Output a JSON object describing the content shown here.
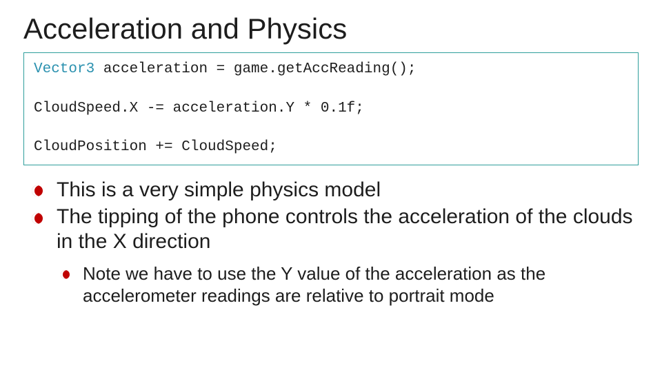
{
  "title": "Acceleration and Physics",
  "code": {
    "line1_type": "Vector3",
    "line1_rest": " acceleration = game.getAccReading();",
    "line2": "CloudSpeed.X -= acceleration.Y * 0.1f;",
    "line3": "CloudPosition += CloudSpeed;"
  },
  "bullets": {
    "b1": "This is a very simple physics model",
    "b2": "The tipping of the phone controls the acceleration of the clouds in the X direction",
    "sub1": "Note we have to use the Y value of the acceleration as the accelerometer readings are relative to portrait mode"
  }
}
